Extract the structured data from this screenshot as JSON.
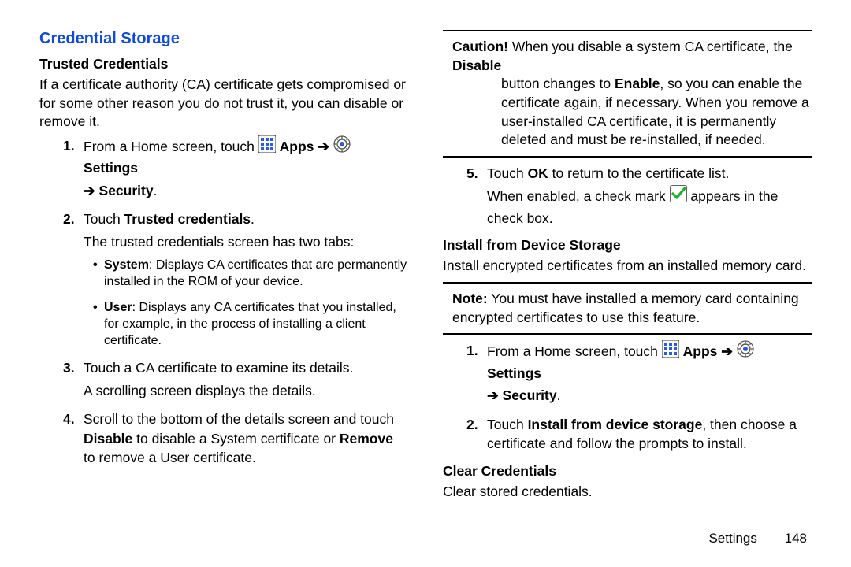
{
  "section_heading": "Credential Storage",
  "left": {
    "sub1": "Trusted Credentials",
    "intro": "If a certificate authority (CA) certificate gets compromised or for some other reason you do not trust it, you can disable or remove it.",
    "steps": {
      "s1_a": "From a Home screen, touch ",
      "s1_apps": " Apps ",
      "s1_settings": " Settings",
      "s1_b": "Security",
      "s2_a": "Touch ",
      "s2_b": "Trusted credentials",
      "s2_c": ".",
      "s2_cont": "The trusted credentials screen has two tabs:",
      "bul1_lead": "System",
      "bul1_text": ": Displays CA certificates that are permanently installed in the ROM of your device.",
      "bul2_lead": "User",
      "bul2_text": ": Displays any CA certificates that you installed, for example, in the process of installing a client certificate.",
      "s3": "Touch a CA certificate to examine its details.",
      "s3_cont": "A scrolling screen displays the details.",
      "s4_a": "Scroll to the bottom of the details screen and touch ",
      "s4_disable": "Disable",
      "s4_b": " to disable a System certificate or ",
      "s4_remove": "Remove",
      "s4_c": " to remove a User certificate."
    }
  },
  "right": {
    "caution_lead": "Caution!",
    "caution_a": " When you disable a system CA certificate, the ",
    "caution_disable": "Disable",
    "caution_b": " button changes to ",
    "caution_enable": "Enable",
    "caution_c": ", so you can enable the certificate again, if necessary. When you remove a user-installed CA certificate, it is permanently deleted and must be re-installed, if needed.",
    "s5_a": "Touch ",
    "s5_ok": "OK",
    "s5_b": " to return to the certificate list.",
    "s5_cont_a": "When enabled, a check mark ",
    "s5_cont_b": " appears in the check box.",
    "sub2": "Install from Device Storage",
    "install_intro": "Install encrypted certificates from an installed memory card.",
    "note_lead": "Note:",
    "note_text": " You must have installed a memory card containing encrypted certificates to use this feature.",
    "install_steps": {
      "s1_a": "From a Home screen, touch ",
      "s1_apps": " Apps ",
      "s1_settings": " Settings",
      "s1_b": "Security",
      "s2_a": "Touch ",
      "s2_b": "Install from device storage",
      "s2_c": ", then choose a certificate and follow the prompts to install."
    },
    "sub3": "Clear Credentials",
    "clear_text": "Clear stored credentials."
  },
  "footer": {
    "section": "Settings",
    "page": "148"
  },
  "arrow": "➔",
  "arrow_pre": "➔ "
}
